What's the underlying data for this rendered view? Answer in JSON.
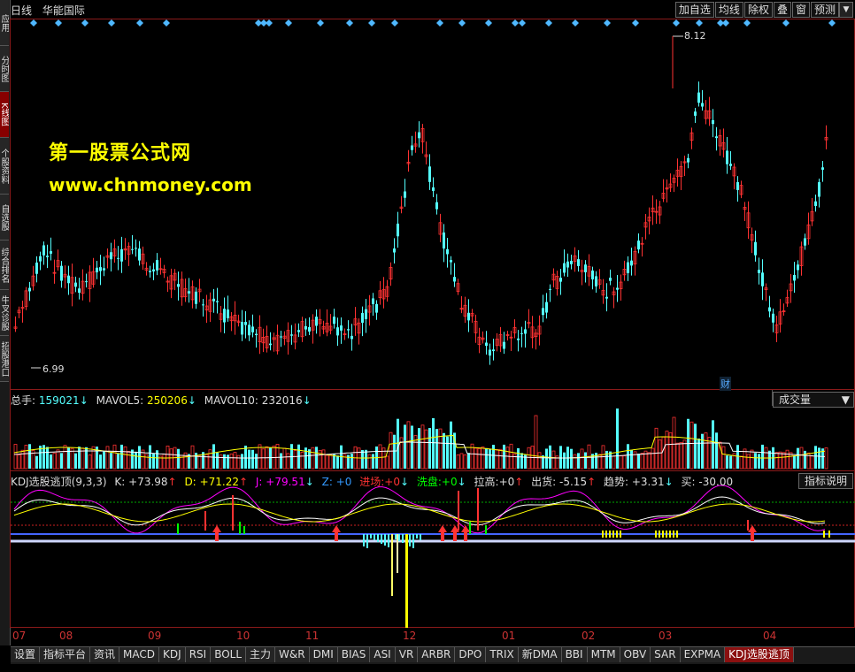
{
  "sidebar": {
    "tabs": [
      "应用",
      "分时图",
      "K线图",
      "个股资料",
      "自选股",
      "综合排名",
      "牛叉诊股",
      "招股港口"
    ],
    "active_index": 2
  },
  "header": {
    "period": "日线",
    "stock_name": "华能国际",
    "buttons": [
      "加自选",
      "均线",
      "除权",
      "叠",
      "窗",
      "预测"
    ]
  },
  "watermark": {
    "line1": "第一股票公式网",
    "line2": "www.chnmoney.com"
  },
  "price_panel": {
    "high_label": "8.12",
    "low_label": "6.99",
    "badge": "财"
  },
  "volume_panel": {
    "total_label": "总手:",
    "total_value": "159021",
    "mavol5_label": "MAVOL5:",
    "mavol5_value": "250206",
    "mavol10_label": "MAVOL10:",
    "mavol10_value": "232016",
    "selector": "成交量"
  },
  "indicator_panel": {
    "name": "KDJ选股逃顶(9,3,3)",
    "k_label": "K:",
    "k_value": "+73.98",
    "d_label": "D:",
    "d_value": "+71.22",
    "j_label": "J:",
    "j_value": "+79.51",
    "z_label": "Z:",
    "z_value": "+0",
    "jc_label": "进场:",
    "jc_value": "+0",
    "xp_label": "洗盘:",
    "xp_value": "+0",
    "lg_label": "拉高:",
    "lg_value": "+0",
    "ch_label": "出货:",
    "ch_value": "-5.15",
    "qs_label": "趋势:",
    "qs_value": "+3.31",
    "buy_label": "买:",
    "buy_value": "-30.00",
    "help_button": "指标说明"
  },
  "x_axis": [
    "07",
    "08",
    "09",
    "10",
    "11",
    "12",
    "01",
    "02",
    "03",
    "04"
  ],
  "bottom_tabs": [
    "设置",
    "指标平台",
    "资讯",
    "MACD",
    "KDJ",
    "RSI",
    "BOLL",
    "主力",
    "W&R",
    "DMI",
    "BIAS",
    "ASI",
    "VR",
    "ARBR",
    "DPO",
    "TRIX",
    "新DMA",
    "BBI",
    "MTM",
    "OBV",
    "SAR",
    "EXPMA",
    "KDJ选股逃顶"
  ],
  "bottom_active": 22,
  "colors": {
    "up": "#ff3232",
    "down": "#54ffff",
    "frame": "#8b1a1a",
    "k_line": "#ffffff",
    "d_line": "#ffff00",
    "j_line": "#ff00ff"
  }
}
